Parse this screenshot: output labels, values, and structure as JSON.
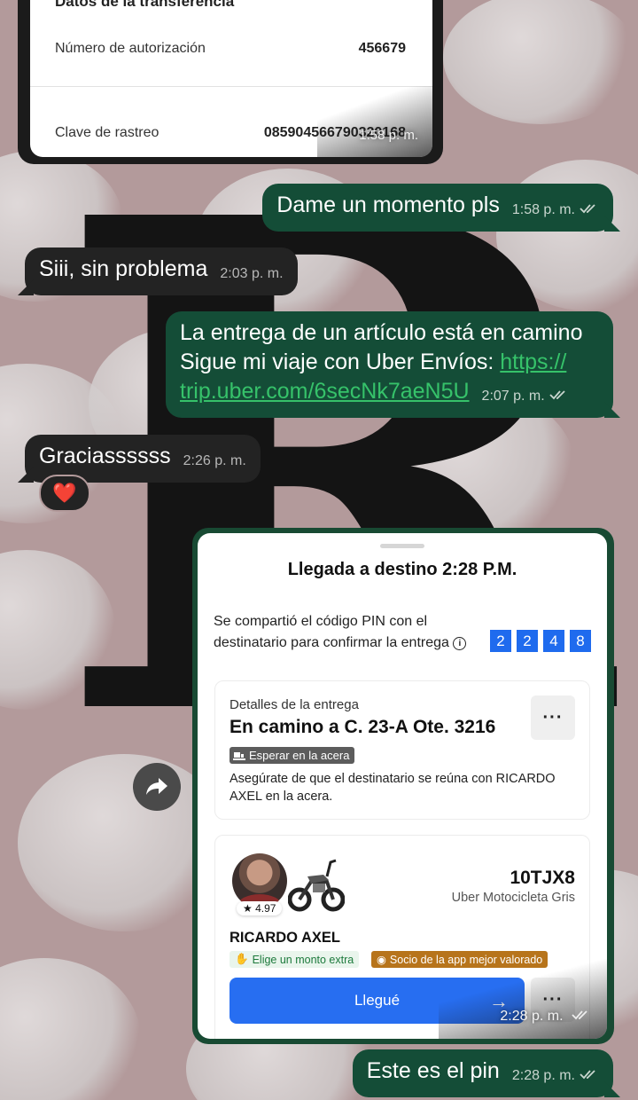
{
  "transfer": {
    "title": "Datos de la transferencia",
    "auth_label": "Número de autorización",
    "auth_value": "456679",
    "tracking_label": "Clave de rastreo",
    "tracking_value": "085904566790320168",
    "time": "1:58 p. m."
  },
  "messages": [
    {
      "direction": "out",
      "text": "Dame un momento pls",
      "time": "1:58 p. m."
    },
    {
      "direction": "in",
      "text": "Siii, sin problema",
      "time": "2:03 p. m."
    },
    {
      "direction": "out",
      "line1": "La entrega de un artículo está en camino",
      "line2_prefix": "Sigue mi viaje con Uber Envíos: ",
      "link_part1": "https://",
      "link_part2": "trip.uber.com/6secNk7aeN5U",
      "time": "2:07 p. m."
    },
    {
      "direction": "in",
      "text": "Graciassssss",
      "time": "2:26 p. m.",
      "reaction": "❤️"
    },
    {
      "direction": "out",
      "text": "Este es el pin",
      "time": "2:28 p. m."
    }
  ],
  "uber_card": {
    "title": "Llegada a destino 2:28 P.M.",
    "pin_text": "Se compartió el código PIN con el destinatario para confirmar la entrega",
    "pin_digits": [
      "2",
      "2",
      "4",
      "8"
    ],
    "details_label": "Detalles de la entrega",
    "destination": "En camino a C. 23-A Ote. 3216",
    "wait_tag": "Esperar en la acera",
    "instruction": "Asegúrate de que el destinatario se reúna con RICARDO AXEL en la acera.",
    "rating": "4.97",
    "plate": "10TJX8",
    "vehicle": "Uber Motocicleta Gris",
    "driver": "RICARDO AXEL",
    "chip_extra": "Elige un monto extra",
    "chip_partner": "Socio de la app mejor valorado",
    "arrive_button": "Llegué",
    "more": "···",
    "time": "2:28 p. m."
  },
  "icons": [
    "forward-icon",
    "double-check-icon",
    "info-icon",
    "star-icon",
    "arrow-right-icon",
    "motorcycle-icon"
  ],
  "colors": {
    "outgoing": "#144d37",
    "incoming": "#232323",
    "pin": "#1f6bee",
    "link": "#36c26a",
    "button": "#276ef1"
  }
}
